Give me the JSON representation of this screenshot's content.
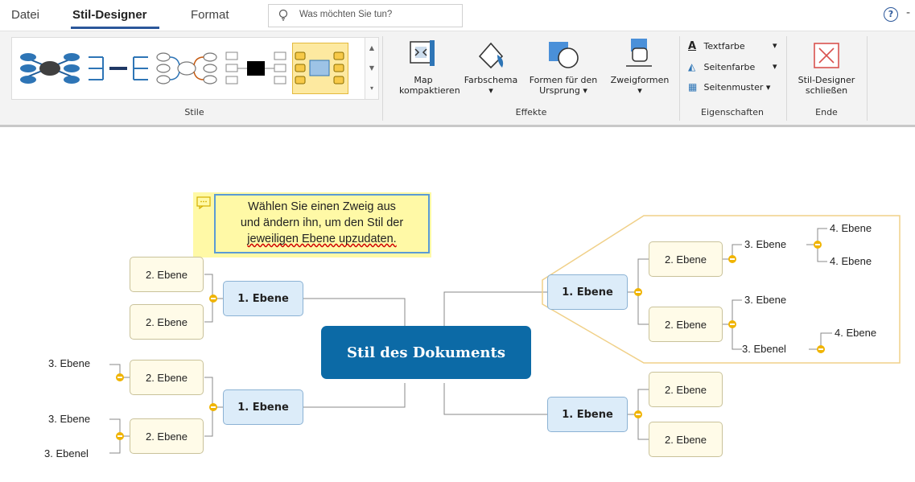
{
  "tabs": {
    "file": "Datei",
    "style_designer": "Stil-Designer",
    "format": "Format"
  },
  "tell_me": {
    "placeholder": "Was möchten Sie tun?"
  },
  "help_symbol": "?",
  "ribbon": {
    "groups": {
      "styles": "Stile",
      "effects": "Effekte",
      "properties": "Eigenschaften",
      "end": "Ende"
    },
    "map_compact": [
      "Map",
      "kompaktieren"
    ],
    "color_scheme": "Farbschema",
    "shapes_origin": [
      "Formen für den",
      "Ursprung"
    ],
    "branch_shapes": "Zweigformen",
    "text_color": "Textfarbe",
    "page_color": "Seitenfarbe",
    "page_pattern": "Seitenmuster",
    "close_designer": [
      "Stil-Designer",
      "schließen"
    ],
    "dropdown_glyph": "▾"
  },
  "colors": {
    "accent": "#2b579a",
    "root": "#0c6aa6",
    "level1": "#dcecf9",
    "level2": "#fffbe8",
    "collapse_dot": "#f0b400",
    "callout": "#fff9a6"
  },
  "map": {
    "root": "Stil des Dokuments",
    "callout": [
      "Wählen Sie einen Zweig aus",
      "und ändern ihn, um den Stil der",
      "jeweiligen Ebene  upzudaten."
    ],
    "level1": "1. Ebene",
    "level2": "2. Ebene",
    "level3": "3. Ebene",
    "level3_alt": "3. Ebenel",
    "level4": "4. Ebene"
  }
}
